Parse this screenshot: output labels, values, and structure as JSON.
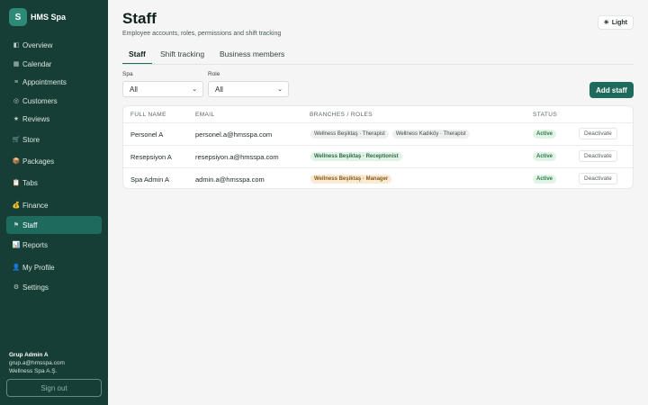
{
  "brand": {
    "logo_letter": "S",
    "name": "HMS Spa"
  },
  "nav": [
    {
      "label": "Overview",
      "icon": "overview-icon",
      "glyph": "◧",
      "active": false
    },
    {
      "label": "Calendar",
      "icon": "calendar-icon",
      "glyph": "▦",
      "active": false
    },
    {
      "label": "Appointments",
      "icon": "appointments-icon",
      "glyph": "≡",
      "active": false
    },
    {
      "label": "Customers",
      "icon": "customers-icon",
      "glyph": "◎",
      "active": false
    },
    {
      "label": "Reviews",
      "icon": "star-icon",
      "glyph": "★",
      "active": false
    },
    {
      "label": "Store",
      "icon": "store-icon",
      "glyph": "🛒",
      "active": false
    },
    {
      "label": "Packages",
      "icon": "package-icon",
      "glyph": "📦",
      "active": false
    },
    {
      "label": "Tabs",
      "icon": "tabs-icon",
      "glyph": "📋",
      "active": false
    },
    {
      "label": "Finance",
      "icon": "finance-icon",
      "glyph": "💰",
      "active": false
    },
    {
      "label": "Staff",
      "icon": "flag-icon",
      "glyph": "⚑",
      "active": true
    },
    {
      "label": "Reports",
      "icon": "reports-icon",
      "glyph": "📊",
      "active": false
    },
    {
      "label": "My Profile",
      "icon": "profile-icon",
      "glyph": "👤",
      "active": false
    },
    {
      "label": "Settings",
      "icon": "settings-icon",
      "glyph": "⚙",
      "active": false
    }
  ],
  "user": {
    "name": "Grup Admin A",
    "email": "grup.a@hmsspa.com",
    "company": "Wellness Spa A.Ş."
  },
  "signout_label": "Sign out",
  "header": {
    "title": "Staff",
    "subtitle": "Employee accounts, roles, permissions and shift tracking",
    "theme_label": "Light",
    "theme_icon": "sun-icon"
  },
  "tabs": [
    {
      "label": "Staff",
      "active": true
    },
    {
      "label": "Shift tracking",
      "active": false
    },
    {
      "label": "Business members",
      "active": false
    }
  ],
  "filters": {
    "spa": {
      "label": "Spa",
      "value": "All"
    },
    "role": {
      "label": "Role",
      "value": "All"
    }
  },
  "add_staff_label": "Add staff",
  "table": {
    "headers": [
      "FULL NAME",
      "EMAIL",
      "BRANCHES / ROLES",
      "STATUS"
    ],
    "rows": [
      {
        "name": "Personel A",
        "email": "personel.a@hmsspa.com",
        "roles": [
          {
            "text": "Wellness Beşiktaş · Therapist",
            "tone": "grey"
          },
          {
            "text": "Wellness Kadıköy · Therapist",
            "tone": "grey"
          }
        ],
        "status": "Active",
        "action": "Deactivate"
      },
      {
        "name": "Resepsiyon A",
        "email": "resepsiyon.a@hmsspa.com",
        "roles": [
          {
            "text": "Wellness Beşiktaş · Receptionist",
            "tone": "green"
          }
        ],
        "status": "Active",
        "action": "Deactivate"
      },
      {
        "name": "Spa Admin A",
        "email": "admin.a@hmsspa.com",
        "roles": [
          {
            "text": "Wellness Beşiktaş · Manager",
            "tone": "amber"
          }
        ],
        "status": "Active",
        "action": "Deactivate"
      }
    ]
  }
}
